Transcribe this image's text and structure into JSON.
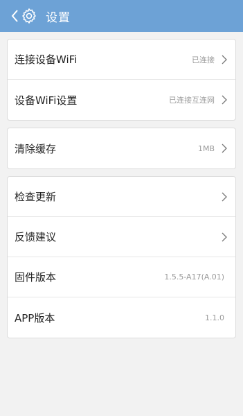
{
  "header": {
    "title": "设置"
  },
  "groups": {
    "network": [
      {
        "label": "连接设备WiFi",
        "value": "已连接"
      },
      {
        "label": "设备WiFi设置",
        "value": "已连接互连网"
      }
    ],
    "cache": [
      {
        "label": "清除缓存",
        "value": "1MB"
      }
    ],
    "about": [
      {
        "label": "检查更新"
      },
      {
        "label": "反馈建议"
      },
      {
        "label": "固件版本",
        "value": "1.5.5-A17(A.01)"
      },
      {
        "label": "APP版本",
        "value": "1.1.0"
      }
    ]
  },
  "icons": {
    "back": "chevron-left-icon",
    "settings": "gear-icon",
    "row_arrow": "chevron-right-icon"
  },
  "colors": {
    "header_bg": "#6da2d6",
    "page_bg": "#f2f2f2",
    "secondary_text": "#9a9a9a"
  }
}
